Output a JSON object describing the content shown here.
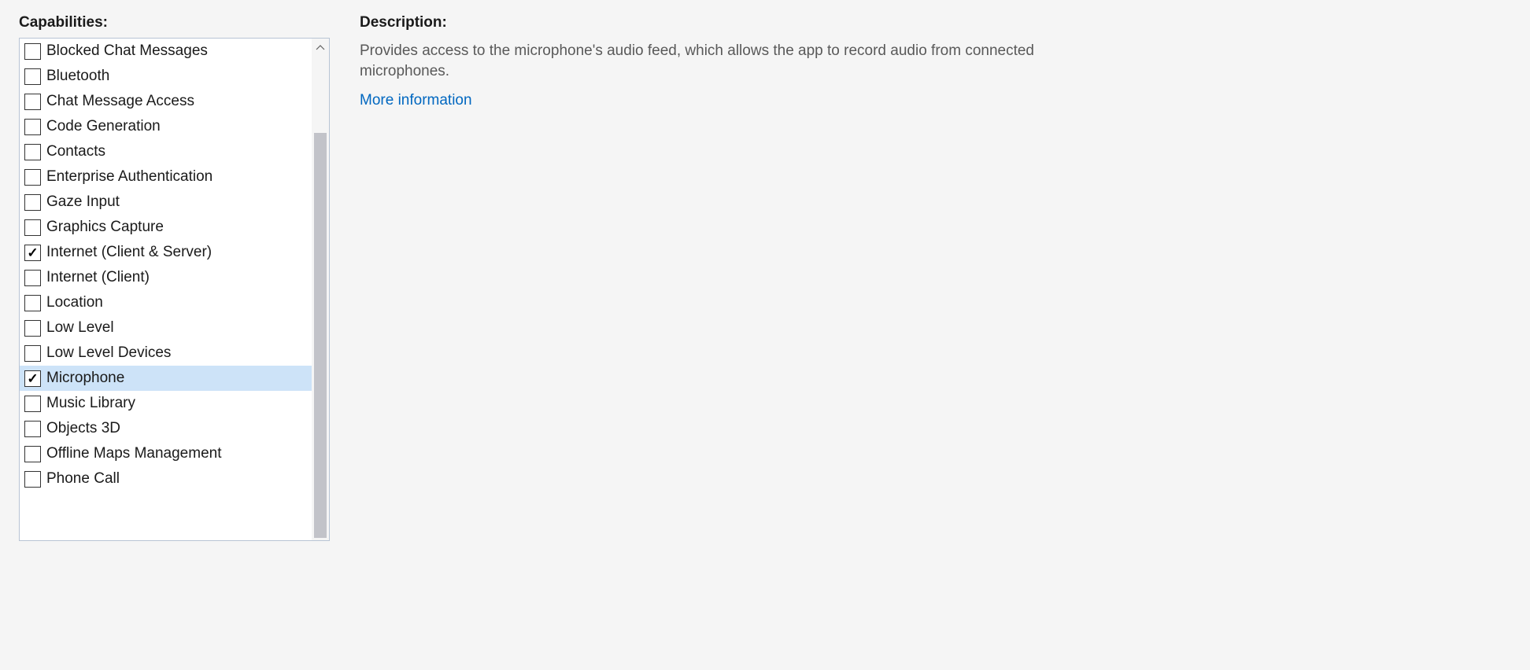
{
  "left": {
    "heading": "Capabilities:",
    "items": [
      {
        "label": "Blocked Chat Messages",
        "checked": false,
        "selected": false
      },
      {
        "label": "Bluetooth",
        "checked": false,
        "selected": false
      },
      {
        "label": "Chat Message Access",
        "checked": false,
        "selected": false
      },
      {
        "label": "Code Generation",
        "checked": false,
        "selected": false
      },
      {
        "label": "Contacts",
        "checked": false,
        "selected": false
      },
      {
        "label": "Enterprise Authentication",
        "checked": false,
        "selected": false
      },
      {
        "label": "Gaze Input",
        "checked": false,
        "selected": false
      },
      {
        "label": "Graphics Capture",
        "checked": false,
        "selected": false
      },
      {
        "label": "Internet (Client & Server)",
        "checked": true,
        "selected": false
      },
      {
        "label": "Internet (Client)",
        "checked": false,
        "selected": false
      },
      {
        "label": "Location",
        "checked": false,
        "selected": false
      },
      {
        "label": "Low Level",
        "checked": false,
        "selected": false
      },
      {
        "label": "Low Level Devices",
        "checked": false,
        "selected": false
      },
      {
        "label": "Microphone",
        "checked": true,
        "selected": true
      },
      {
        "label": "Music Library",
        "checked": false,
        "selected": false
      },
      {
        "label": "Objects 3D",
        "checked": false,
        "selected": false
      },
      {
        "label": "Offline Maps Management",
        "checked": false,
        "selected": false
      },
      {
        "label": "Phone Call",
        "checked": false,
        "selected": false
      }
    ]
  },
  "right": {
    "heading": "Description:",
    "description": "Provides access to the microphone's audio feed, which allows the app to record audio from connected microphones.",
    "more_info_label": "More information"
  }
}
